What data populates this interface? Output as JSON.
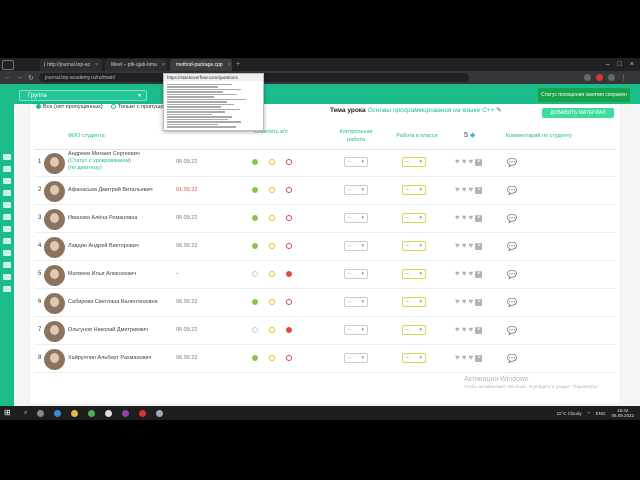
{
  "browser": {
    "tabs": [
      {
        "title": "http://journal.top-ac"
      },
      {
        "title": "Meet – pfk-qjab-bma"
      },
      {
        "title": "method-package.cpp"
      }
    ],
    "url": "journal.top-academy.ru/ru/main/",
    "popup_url": "https://stackoverflow.com/questions"
  },
  "header": {
    "group": "Группа",
    "status_button": "Статус посещения занятия сохранен"
  },
  "filters": {
    "options": [
      "Все (нет пропущенных)",
      "Только с пропущенными"
    ]
  },
  "lesson": {
    "theme_label": "Тема урока",
    "theme": "Основы программирования на языке C++",
    "add_material": "ДОБАВИТЬ МАТЕРИАЛ"
  },
  "table": {
    "headers": {
      "name": "ФИО студента",
      "attendance": "Отметить в/п",
      "control": "Контрольная работа",
      "classwork": "Работа в классе",
      "diamonds": "5",
      "comment": "Комментарий по студенту"
    },
    "rows": [
      {
        "num": "1",
        "name": "Андреев Михаил Сергеевич",
        "name_extra": "(Статус с урокрованием)",
        "name_extra2": "(по диагнозу)",
        "date": "06.09.22",
        "date_red": false,
        "att": [
          "g",
          "y",
          "r"
        ]
      },
      {
        "num": "2",
        "name": "Афанасьев Дмитрий Витальевич",
        "name_extra": "",
        "name_extra2": "",
        "date": "01.09.22",
        "date_red": true,
        "att": [
          "g",
          "y",
          "r"
        ]
      },
      {
        "num": "3",
        "name": "Иванова Алёна Романовна",
        "name_extra": "",
        "name_extra2": "",
        "date": "06.09.22",
        "date_red": false,
        "att": [
          "g",
          "y",
          "r"
        ]
      },
      {
        "num": "4",
        "name": "Лавдин Андрей Викторович",
        "name_extra": "",
        "name_extra2": "",
        "date": "06.09.22",
        "date_red": false,
        "att": [
          "g",
          "y",
          "r"
        ]
      },
      {
        "num": "5",
        "name": "Матвеев Илья Алексеевич",
        "name_extra": "",
        "name_extra2": "",
        "date": "–",
        "date_red": false,
        "att": [
          "o",
          "y",
          "rf"
        ]
      },
      {
        "num": "6",
        "name": "Сабирова Светлана Валентиновна",
        "name_extra": "",
        "name_extra2": "",
        "date": "06.09.22",
        "date_red": false,
        "att": [
          "g",
          "y",
          "r"
        ]
      },
      {
        "num": "7",
        "name": "Ольгунов Николай Дмитриевич",
        "name_extra": "",
        "name_extra2": "",
        "date": "06.09.22",
        "date_red": false,
        "att": [
          "o",
          "y",
          "rf"
        ]
      },
      {
        "num": "8",
        "name": "Хайруллин Альберт Рахманович",
        "name_extra": "",
        "name_extra2": "",
        "date": "06.09.22",
        "date_red": false,
        "att": [
          "g",
          "y",
          "r"
        ]
      }
    ],
    "select_placeholder": "–"
  },
  "watermark": {
    "title": "Активация Windows",
    "sub": "Чтобы активировать Windows, перейдите в раздел \"Параметры\"."
  },
  "taskbar": {
    "weather": "11°C Cloudy",
    "lang": "ENG",
    "time": "15:42",
    "date": "06.09.2022"
  }
}
